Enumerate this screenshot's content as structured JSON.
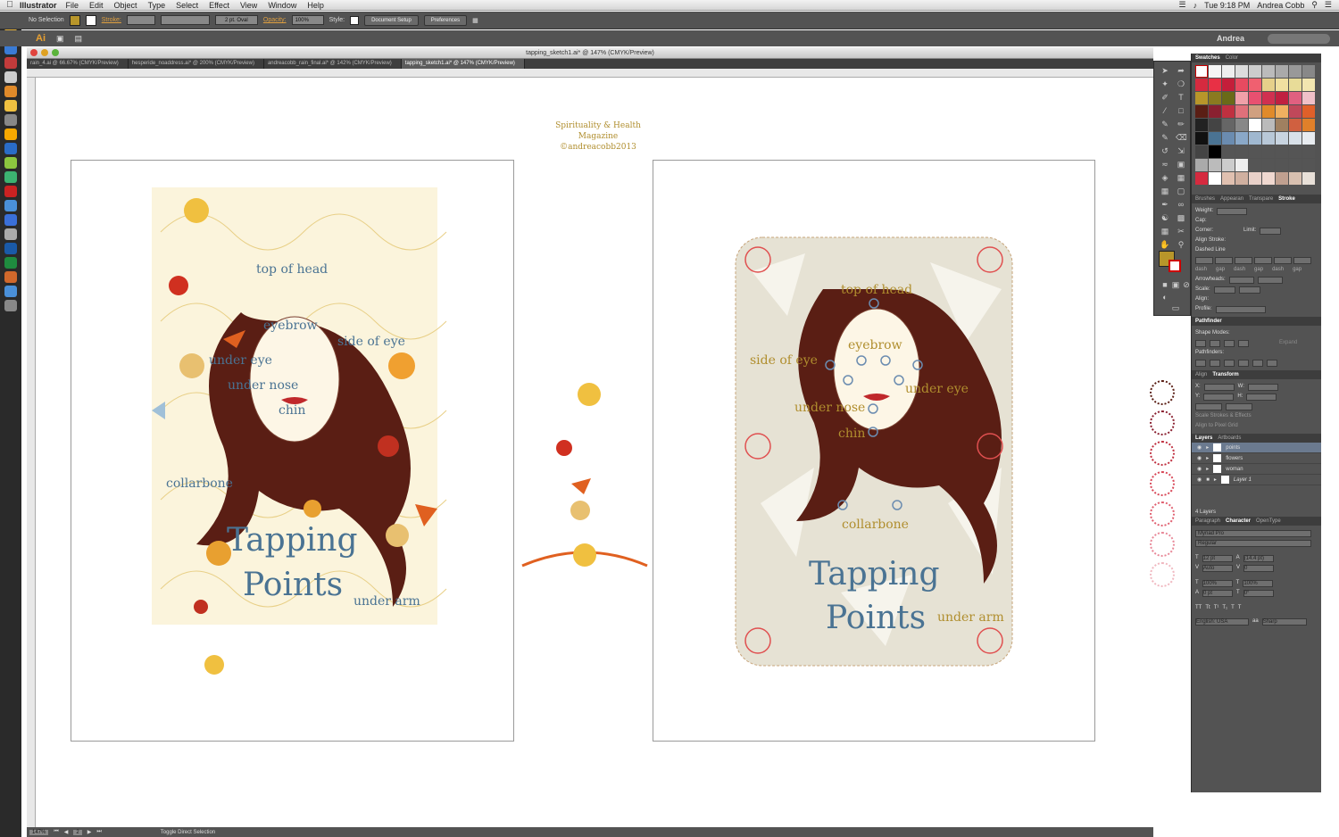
{
  "menubar": {
    "app": "Illustrator",
    "items": [
      "File",
      "Edit",
      "Object",
      "Type",
      "Select",
      "Effect",
      "View",
      "Window",
      "Help"
    ],
    "clock": "Tue 9:18 PM",
    "user": "Andrea Cobb"
  },
  "control": {
    "selection": "No Selection",
    "stroke_label": "Stroke:",
    "brush": "2 pt. Oval",
    "opacity_label": "Opacity:",
    "opacity": "100%",
    "style_label": "Style:",
    "doc_setup": "Document Setup",
    "prefs": "Preferences"
  },
  "appbar": {
    "logo": "Ai",
    "workspace": "Andrea"
  },
  "window": {
    "title": "tapping_sketch1.ai* @ 147% (CMYK/Preview)"
  },
  "tabs": [
    {
      "label": "rain_4.ai @ 66.67% (CMYK/Preview)"
    },
    {
      "label": "hesperide_noaddress.ai* @ 200% (CMYK/Preview)"
    },
    {
      "label": "andreacobb_rain_final.ai* @ 142% (CMYK/Preview)"
    },
    {
      "label": "tapping_sketch1.ai* @ 147% (CMYK/Preview)"
    }
  ],
  "canvas": {
    "credit_line1": "Spirituality & Health Magazine",
    "credit_line2": "©andreacobb2013",
    "left_art": {
      "labels": [
        "top of head",
        "eyebrow",
        "side of eye",
        "under eye",
        "under nose",
        "chin",
        "collarbone",
        "under arm"
      ],
      "title1": "Tapping",
      "title2": "Points"
    },
    "right_art": {
      "labels": [
        "top of head",
        "eyebrow",
        "side of eye",
        "under eye",
        "under nose",
        "chin",
        "collarbone",
        "under arm"
      ],
      "title1": "Tapping",
      "title2": "Points"
    }
  },
  "status": {
    "zoom": "147%",
    "page": "2",
    "message": "Toggle Direct Selection"
  },
  "panels": {
    "swatches_tabs": [
      "Swatches",
      "Color"
    ],
    "brushes_tabs": [
      "Brushes",
      "Appearan",
      "Transpare",
      "Stroke"
    ],
    "stroke": {
      "weight_label": "Weight:",
      "cap_label": "Cap:",
      "corner_label": "Corner:",
      "limit_label": "Limit:",
      "align_label": "Align Stroke:",
      "dashed": "Dashed Line",
      "dash": "dash",
      "gap": "gap",
      "arrowheads": "Arrowheads:",
      "scale": "Scale:",
      "align2": "Align:",
      "profile": "Profile:"
    },
    "pathfinder": {
      "title": "Pathfinder",
      "shape_modes": "Shape Modes:",
      "pathfinders": "Pathfinders:",
      "expand": "Expand"
    },
    "transform_tabs": [
      "Align",
      "Transform"
    ],
    "transform_opts": [
      "Scale Strokes & Effects",
      "Align to Pixel Grid"
    ],
    "layers_tabs": [
      "Layers",
      "Artboards"
    ],
    "layers": [
      {
        "name": "points"
      },
      {
        "name": "flowers"
      },
      {
        "name": "woman"
      },
      {
        "name": "Layer 1"
      }
    ],
    "layers_count": "4 Layers",
    "char_tabs": [
      "Paragraph",
      "Character",
      "OpenType"
    ],
    "character": {
      "font": "Myriad Pro",
      "style": "Regular",
      "size": "12 pt",
      "leading": "(14.4 pt)",
      "kerning": "Auto",
      "tracking": "0",
      "hscale": "100%",
      "vscale": "100%",
      "baseline": "0 pt",
      "rotation": "0°",
      "language": "English: USA",
      "aa": "Sharp"
    }
  },
  "colors": {
    "label_blue": "#4a7393",
    "label_gold": "#b08e2e",
    "hair": "#5a1e14",
    "fill_swatch": "#b8962a"
  }
}
